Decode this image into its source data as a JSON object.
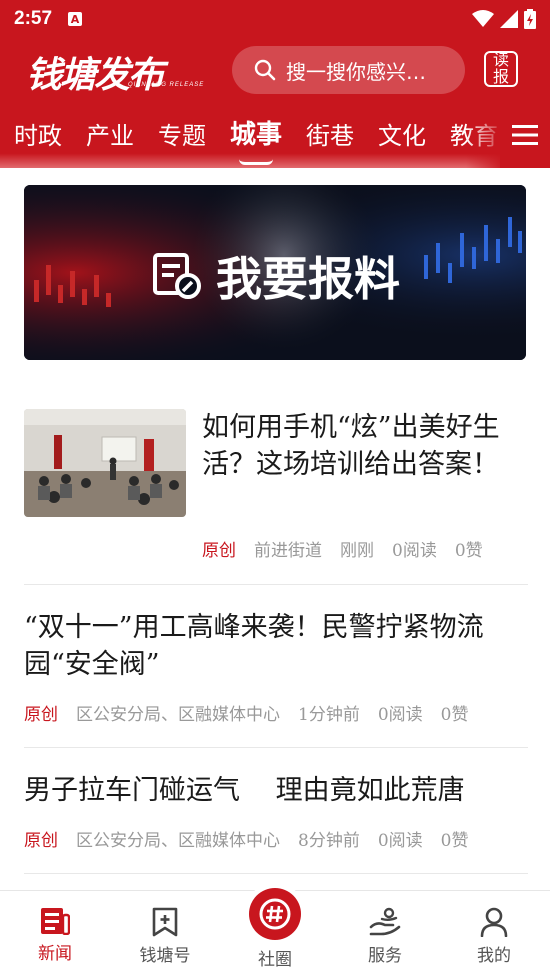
{
  "status_bar": {
    "time": "2:57",
    "notification_icon": "A"
  },
  "header": {
    "logo_text": "钱塘发布",
    "logo_subtitle": "QIANTANG RELEASE",
    "search_placeholder": "搜一搜你感兴…",
    "report_label": "读报"
  },
  "tabs": [
    {
      "label": "时政"
    },
    {
      "label": "产业"
    },
    {
      "label": "专题"
    },
    {
      "label": "城事",
      "active": true
    },
    {
      "label": "街巷"
    },
    {
      "label": "文化"
    },
    {
      "label": "教育"
    }
  ],
  "banner": {
    "title": "我要报料"
  },
  "news": [
    {
      "title": "如何用手机“炫”出美好生活？这场培训给出答案！",
      "tag": "原创",
      "source": "前进街道",
      "time": "刚刚",
      "reads": "0阅读",
      "likes": "0赞"
    },
    {
      "title": "“双十一”用工高峰来袭！民警拧紧物流园“安全阀”",
      "tag": "原创",
      "source": "区公安分局、区融媒体中心",
      "time": "1分钟前",
      "reads": "0阅读",
      "likes": "0赞"
    },
    {
      "title": "男子拉车门碰运气　 理由竟如此荒唐",
      "tag": "原创",
      "source": "区公安分局、区融媒体中心",
      "time": "8分钟前",
      "reads": "0阅读",
      "likes": "0赞"
    }
  ],
  "bottom_nav": [
    {
      "label": "新闻",
      "icon": "news-icon",
      "active": true
    },
    {
      "label": "钱塘号",
      "icon": "bookmark-plus-icon"
    },
    {
      "label": "社圈",
      "icon": "hashtag-icon"
    },
    {
      "label": "服务",
      "icon": "service-icon"
    },
    {
      "label": "我的",
      "icon": "profile-icon"
    }
  ],
  "colors": {
    "brand": "#c8161e",
    "text": "#1a1a1a",
    "meta": "#999999"
  }
}
